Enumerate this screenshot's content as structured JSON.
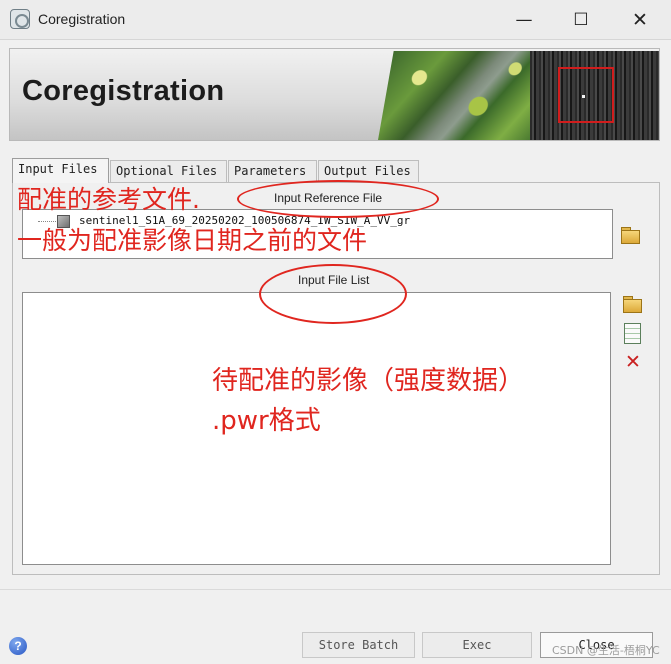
{
  "window": {
    "title": "Coregistration",
    "controls": {
      "minimize": "—",
      "maximize": "☐",
      "close": "✕"
    }
  },
  "banner": {
    "title": "Coregistration"
  },
  "tabs": [
    {
      "label": "Input Files",
      "active": true
    },
    {
      "label": "Optional Files",
      "active": false
    },
    {
      "label": "Parameters",
      "active": false
    },
    {
      "label": "Output Files",
      "active": false
    }
  ],
  "input_files": {
    "reference_label": "Input Reference File",
    "reference_file": "sentinel1_S1A_69_20250202_100506874_IW_SIW_A_VV_gr",
    "list_label": "Input File List",
    "list_items": []
  },
  "annotations": {
    "line1": "配准的参考文件.",
    "line2": "一般为配准影像日期之前的文件",
    "line3": "待配准的影像（强度数据）",
    "line4": ".pwr格式",
    "color": "#e0261f"
  },
  "footer": {
    "help": "?",
    "store_batch": "Store Batch",
    "exec": "Exec",
    "close": "Close",
    "watermark": "CSDN @生活-梧桐YC"
  },
  "icons": {
    "app": "app-logo-icon",
    "folder": "folder-open-icon",
    "sheet": "file-list-icon",
    "remove": "delete-x-icon",
    "help": "help-icon"
  }
}
